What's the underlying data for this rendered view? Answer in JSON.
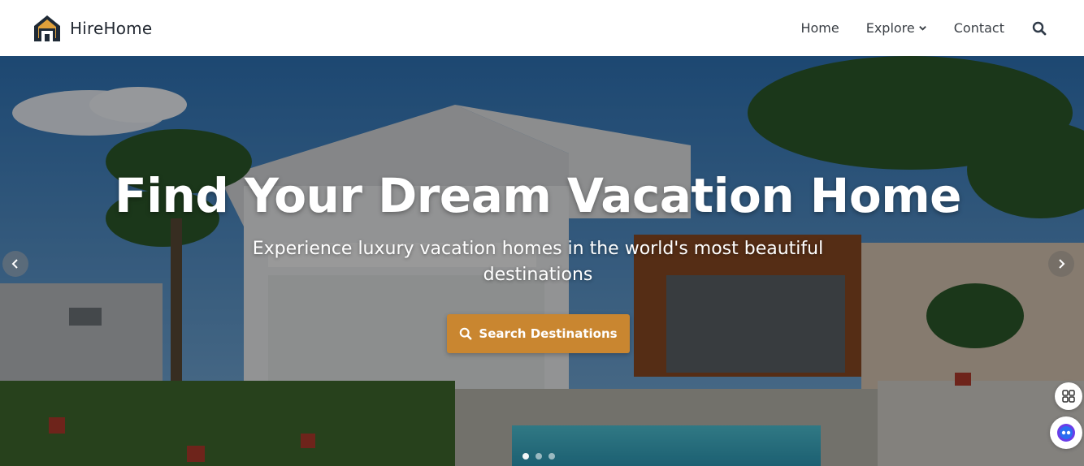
{
  "brand": {
    "name": "HireHome",
    "logo_icon": "house-logo-icon"
  },
  "nav": {
    "items": [
      {
        "label": "Home"
      },
      {
        "label": "Explore",
        "icon": "chevron-down-icon"
      },
      {
        "label": "Contact"
      }
    ],
    "search_icon": "search-icon"
  },
  "hero": {
    "title": "Find Your Dream Vacation Home",
    "subtitle": "Experience luxury vacation homes in the world's most beautiful destinations",
    "cta_label": "Search Destinations",
    "cta_icon": "search-icon",
    "carousel": {
      "slide_count": 3,
      "active_slide": 1
    }
  },
  "colors": {
    "accent": "#c98630",
    "nav_text": "#3a3f45",
    "brand_text": "#222831",
    "logo_roof": "#1f2a36",
    "logo_door": "#e0a03a"
  },
  "floating_buttons": [
    {
      "icon": "grid-apps-icon"
    },
    {
      "icon": "assistant-bot-icon"
    }
  ]
}
